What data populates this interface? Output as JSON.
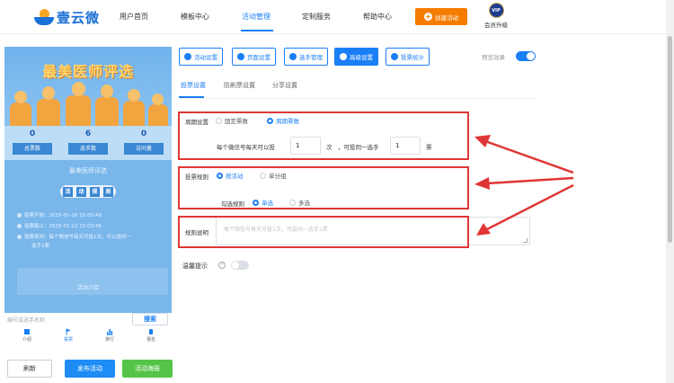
{
  "brand": {
    "name": "壹云微"
  },
  "nav": {
    "items": [
      "用户首页",
      "模板中心",
      "活动管理",
      "定制服务",
      "帮助中心"
    ],
    "create_label": "创建活动",
    "vip_badge": "VIP",
    "vip_label": "会员升级"
  },
  "preview": {
    "banner_title": "最美医师评选",
    "stats": [
      {
        "value": "0",
        "label": "总票数"
      },
      {
        "value": "6",
        "label": "选手数"
      },
      {
        "value": "0",
        "label": "访问量"
      }
    ],
    "subtitle": "最美医师评选",
    "rules_chars": [
      "活",
      "动",
      "规",
      "则"
    ],
    "rules": [
      "投票开始：2025-01-16 15:03:49",
      "投票截止：2025-01-22 15:03:49",
      "投票规则：每个微信号每天可投1次，可以投同一",
      "选手1票"
    ],
    "more_label": "活动介绍",
    "search_placeholder": "编号或选手名称",
    "search_label": "搜索",
    "tabs": [
      "介绍",
      "投票",
      "排行",
      "报名"
    ],
    "active_tab": "投票"
  },
  "actions": {
    "refresh": "刷新",
    "publish": "发布活动",
    "poster": "活动海报"
  },
  "toolbar": {
    "buttons": [
      "活动设置",
      "页面设置",
      "选手管理",
      "高级设置",
      "投票统计"
    ],
    "active": "高级设置",
    "preview_label": "预览效果",
    "preview_on": true
  },
  "subtabs": {
    "items": [
      "投票设置",
      "防刷票设置",
      "分享设置"
    ],
    "active": "投票设置"
  },
  "form": {
    "period": {
      "label": "周期设置",
      "options": [
        "固定票数",
        "周期票数"
      ],
      "selected": "周期票数",
      "line_prefix": "每个微信号每天可以投",
      "daily_votes": "1",
      "unit1": "次",
      "line_mid": "，可投同一选手",
      "same_votes": "1",
      "unit2": "票"
    },
    "rule": {
      "label": "投票规则",
      "options": [
        "按活动",
        "单分组"
      ],
      "selected": "按活动",
      "check_label": "勾选规则",
      "check_options": [
        "单选",
        "多选"
      ],
      "check_selected": "单选"
    },
    "desc": {
      "label": "规则说明",
      "placeholder": "每个微信号每天可投1次，可投同一选手1票"
    },
    "tip": {
      "label": "温馨提示",
      "q": "?",
      "on": false
    }
  },
  "colors": {
    "accent": "#1a7ff5",
    "highlight": "#e03535",
    "orange": "#f57c00",
    "green": "#56c448"
  }
}
